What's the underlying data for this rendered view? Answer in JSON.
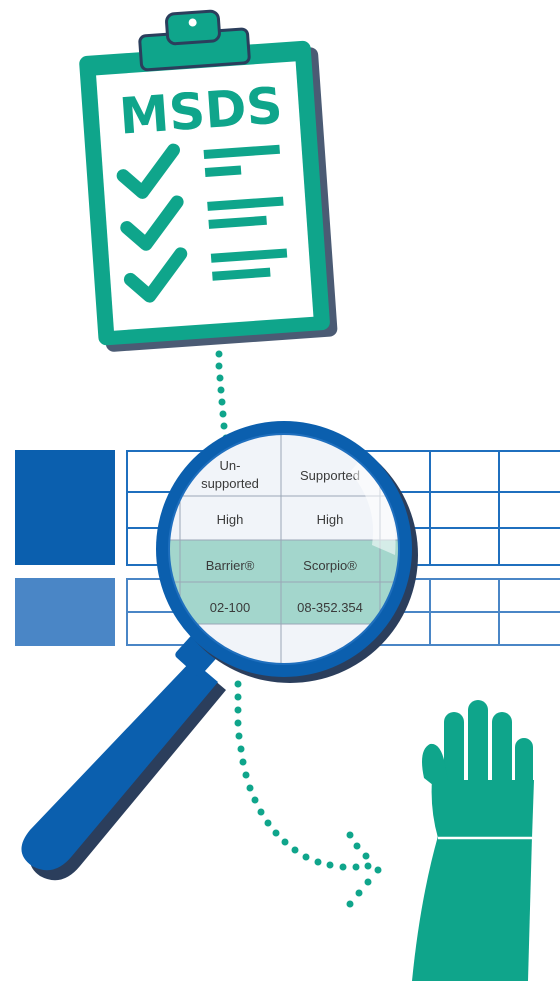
{
  "clipboard": {
    "title": "MSDS",
    "checklist_count": 3
  },
  "magnifier": {
    "rows": [
      [
        "Un-\nsupported",
        "Supported"
      ],
      [
        "High",
        "High"
      ],
      [
        "Barrier®",
        "Scorpio®"
      ],
      [
        "02-100",
        "08-352.354"
      ],
      [
        "",
        ""
      ]
    ],
    "highlighted_rows": [
      2,
      3
    ]
  },
  "colors": {
    "teal": "#0fa58b",
    "teal_light": "#a3d6cc",
    "blue_dark": "#0b5fae",
    "blue_mid": "#1f6fbe",
    "blue_light": "#4a86c6",
    "outline": "#2b3e5c",
    "glove": "#0fa58b"
  },
  "icons": [
    "clipboard-icon",
    "checkmark-icon",
    "magnifying-glass-icon",
    "glove-icon",
    "dotted-arrow-icon"
  ]
}
